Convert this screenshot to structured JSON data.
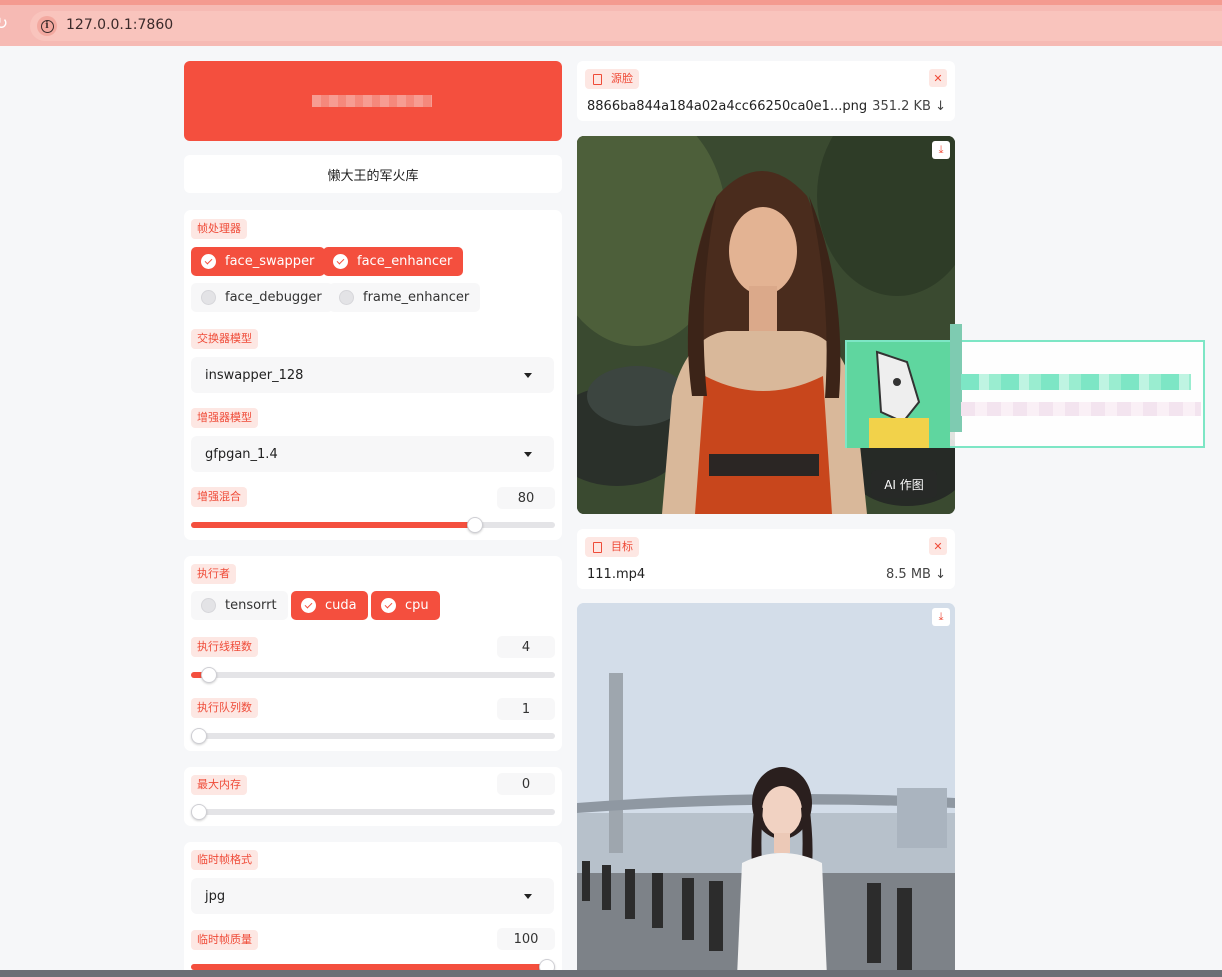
{
  "browser": {
    "url": "127.0.0.1:7860"
  },
  "title_box": {
    "text": "懒大王的军火库"
  },
  "frame_processors": {
    "label": "帧处理器",
    "options": [
      {
        "name": "face_swapper",
        "checked": true
      },
      {
        "name": "face_enhancer",
        "checked": true
      },
      {
        "name": "face_debugger",
        "checked": false
      },
      {
        "name": "frame_enhancer",
        "checked": false
      }
    ]
  },
  "swapper_model": {
    "label": "交换器模型",
    "value": "inswapper_128"
  },
  "enhancer_model": {
    "label": "增强器模型",
    "value": "gfpgan_1.4"
  },
  "enhancer_blend": {
    "label": "增强混合",
    "value": "80",
    "fraction": 0.78
  },
  "execution_providers": {
    "label": "执行者",
    "options": [
      {
        "name": "tensorrt",
        "checked": false
      },
      {
        "name": "cuda",
        "checked": true
      },
      {
        "name": "cpu",
        "checked": true
      }
    ]
  },
  "execution_threads": {
    "label": "执行线程数",
    "value": "4",
    "fraction": 0.05
  },
  "execution_queue": {
    "label": "执行队列数",
    "value": "1",
    "fraction": 0.0
  },
  "max_memory": {
    "label": "最大内存",
    "value": "0",
    "fraction": 0.0
  },
  "temp_frame_format": {
    "label": "临时帧格式",
    "value": "jpg"
  },
  "temp_frame_quality": {
    "label": "临时帧质量",
    "value": "100",
    "fraction": 1.0
  },
  "source_file": {
    "label": "源脸",
    "filename": "8866ba844a184a02a4cc66250ca0e1...png",
    "size": "351.2 KB ↓"
  },
  "source_image": {
    "badge": "AI 作图"
  },
  "target_file": {
    "label": "目标",
    "filename": "111.mp4",
    "size": "8.5 MB ↓"
  },
  "icons": {
    "reload": "reload-icon",
    "info": "info-icon",
    "file": "file-icon",
    "close": "close-icon",
    "download": "download-icon",
    "dropdown": "chevron-down-icon",
    "check": "check-icon"
  },
  "colors": {
    "accent": "#f44f3e",
    "label_bg": "#fde7e3",
    "browser_bar": "#f6bab4"
  }
}
